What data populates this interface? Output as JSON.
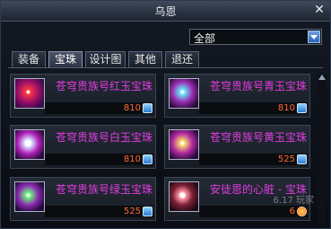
{
  "window": {
    "title": "乌恩"
  },
  "filter": {
    "selected": "全部"
  },
  "tabs": [
    {
      "label": "装备"
    },
    {
      "label": "宝珠"
    },
    {
      "label": "设计图"
    },
    {
      "label": "其他"
    },
    {
      "label": "退还"
    }
  ],
  "active_tab": "宝珠",
  "items": [
    {
      "name": "苍穹贵族号红玉宝珠",
      "price": "810",
      "icon": "orb-red-icon",
      "currency_icon": "blue-gem-icon"
    },
    {
      "name": "苍穹贵族号青玉宝珠",
      "price": "810",
      "icon": "orb-cyan-icon",
      "currency_icon": "blue-gem-icon"
    },
    {
      "name": "苍穹贵族号白玉宝珠",
      "price": "810",
      "icon": "orb-white-icon",
      "currency_icon": "blue-gem-icon"
    },
    {
      "name": "苍穹贵族号黄玉宝珠",
      "price": "525",
      "icon": "orb-yellow-icon",
      "currency_icon": "blue-gem-icon"
    },
    {
      "name": "苍穹贵族号绿玉宝珠",
      "price": "525",
      "icon": "orb-green-icon",
      "currency_icon": "blue-gem-icon"
    },
    {
      "name": "安徒恩的心脏 - 宝珠",
      "price": "6",
      "icon": "heart-orb-icon",
      "currency_icon": "heart-coin-icon"
    }
  ],
  "watermark": "6.17 玩家",
  "colors": {
    "item_name": "#e23ce0",
    "price": "#ff6a2f",
    "accent_blue": "#2f63b4"
  }
}
